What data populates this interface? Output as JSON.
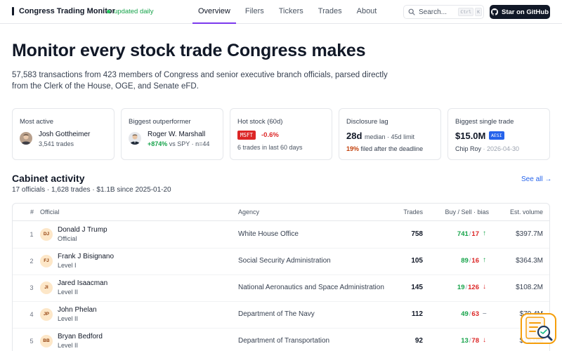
{
  "nav": {
    "brand": "Congress Trading Monitor",
    "status": "updated daily",
    "links": [
      "Overview",
      "Filers",
      "Tickers",
      "Trades",
      "About"
    ],
    "active": "Overview",
    "search_placeholder": "Search...",
    "shortcut_keys": [
      "Ctrl",
      "K"
    ],
    "github_label": "Star on GitHub"
  },
  "hero": {
    "title": "Monitor every stock trade Congress makes",
    "subtitle": "57,583 transactions from 423 members of Congress and senior executive branch officials, parsed directly from the Clerk of the House, OGE, and Senate eFD."
  },
  "cards": {
    "most_active": {
      "label": "Most active",
      "name": "Josh Gottheimer",
      "meta": "3,541 trades"
    },
    "outperformer": {
      "label": "Biggest outperformer",
      "name": "Roger W. Marshall",
      "gain": "+874%",
      "meta": "vs SPY · n=44"
    },
    "hot_stock": {
      "label": "Hot stock (60d)",
      "ticker": "MSFT",
      "change": "-0.6%",
      "meta": "6 trades in last 60 days"
    },
    "lag": {
      "label": "Disclosure lag",
      "value": "28d",
      "value_sub": "median · 45d limit",
      "pct": "19%",
      "meta": "filed after the deadline"
    },
    "single_trade": {
      "label": "Biggest single trade",
      "value": "$15.0M",
      "ticker": "AESI",
      "who": "Chip Roy",
      "date": "· 2026-04-30"
    }
  },
  "cabinet": {
    "title": "Cabinet activity",
    "subtitle": "17 officials · 1,628 trades · $1.1B since 2025-01-20",
    "see_all": "See all →",
    "columns": {
      "num": "#",
      "official": "Official",
      "agency": "Agency",
      "trades": "Trades",
      "buysell": "Buy / Sell · bias",
      "volume": "Est. volume"
    },
    "rows": [
      {
        "num": "1",
        "initials": "DJ",
        "name": "Donald J Trump",
        "role": "Official",
        "agency": "White House Office",
        "trades": "758",
        "buy": "741",
        "sell": "17",
        "bias": "up",
        "volume": "$397.7M"
      },
      {
        "num": "2",
        "initials": "FJ",
        "name": "Frank J Bisignano",
        "role": "Level I",
        "agency": "Social Security Administration",
        "trades": "105",
        "buy": "89",
        "sell": "16",
        "bias": "up",
        "volume": "$364.3M"
      },
      {
        "num": "3",
        "initials": "JI",
        "name": "Jared Isaacman",
        "role": "Level II",
        "agency": "National Aeronautics and Space Administration",
        "trades": "145",
        "buy": "19",
        "sell": "126",
        "bias": "down",
        "volume": "$108.2M"
      },
      {
        "num": "4",
        "initials": "JP",
        "name": "John Phelan",
        "role": "Level II",
        "agency": "Department of The Navy",
        "trades": "112",
        "buy": "49",
        "sell": "63",
        "bias": "flat",
        "volume": "$79.4M"
      },
      {
        "num": "5",
        "initials": "BB",
        "name": "Bryan Bedford",
        "role": "Level II",
        "agency": "Department of Transportation",
        "trades": "92",
        "buy": "13",
        "sell": "78",
        "bias": "down",
        "volume": "$75.0M"
      }
    ]
  },
  "icons": {
    "bias_up": "↑",
    "bias_down": "↓",
    "bias_flat": "–"
  }
}
